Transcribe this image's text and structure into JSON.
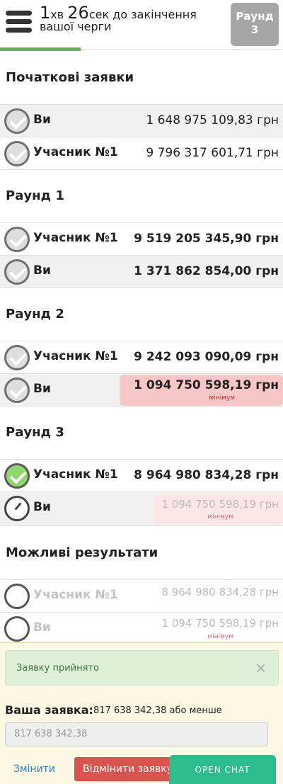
{
  "header": {
    "timer_minutes": "1",
    "timer_min_unit": "хв",
    "timer_seconds": "26",
    "timer_rest": "сек до закінчення вашої черги",
    "round_button": "Раунд 3",
    "progress_percent": 28.5
  },
  "sections": [
    {
      "title": "Початкові заявки",
      "rows": [
        {
          "name": "Ви",
          "amount": "1 648 975 109,83 грн"
        },
        {
          "name": "Учасник №1",
          "amount": "9 796 317 601,71 грн"
        }
      ]
    },
    {
      "title": "Раунд 1",
      "rows": [
        {
          "name": "Учасник №1",
          "amount": "9 519 205 345,90 грн"
        },
        {
          "name": "Ви",
          "amount": "1 371 862 854,00 грн"
        }
      ]
    },
    {
      "title": "Раунд 2",
      "rows": [
        {
          "name": "Учасник №1",
          "amount": "9 242 093 090,09 грн"
        },
        {
          "name": "Ви",
          "amount": "1 094 750 598,19 грн",
          "note": "мінімум"
        }
      ]
    },
    {
      "title": "Раунд 3",
      "rows": [
        {
          "name": "Учасник №1",
          "amount": "8 964 980 834,28 грн"
        },
        {
          "name": "Ви",
          "amount": "1 094 750 598,19 грн",
          "note": "мінімум"
        }
      ]
    },
    {
      "title": "Можливі результати",
      "rows": [
        {
          "name": "Учасник №1",
          "amount": "8 964 980 834,28 грн"
        },
        {
          "name": "Ви",
          "amount": "1 094 750 598,19 грн",
          "note": "мінімум"
        }
      ]
    }
  ],
  "panel": {
    "alert_text": "Заявку прийнято",
    "alert_close": "×",
    "bid_label": "Ваша заявка:",
    "bid_value": "817 638 342,38 або менше",
    "bid_input_value": "817 638 342,38",
    "change_button": "Змінити",
    "cancel_button": "Відмінити заявку",
    "chat_button": "OPEN CHAT"
  },
  "colors": {
    "progress": "#5cb85c",
    "minimum_highlight": "#f7c6c6",
    "minimum_text": "#c9302c",
    "cancel": "#d9534f",
    "chat": "#2bbd8e"
  }
}
